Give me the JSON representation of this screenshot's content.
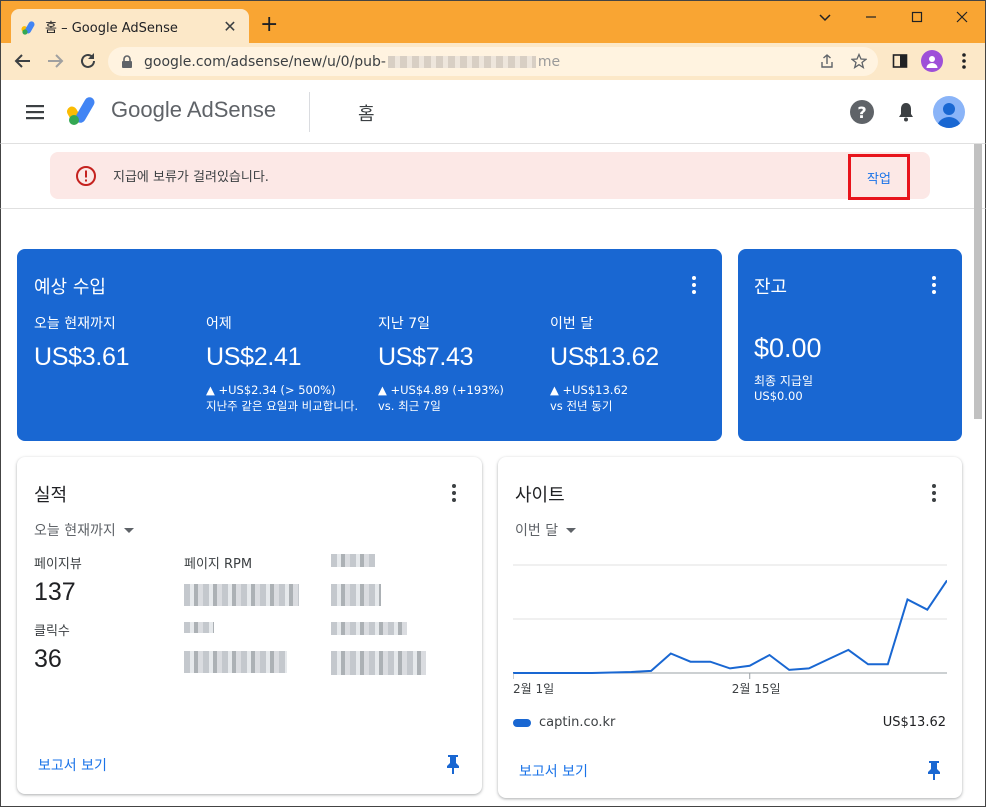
{
  "browser": {
    "tab_title": "홈 – Google AdSense",
    "tab_close": "✕",
    "new_tab": "+",
    "url_start": "google.com/adsense/new/u/0/pub-",
    "url_end": "me",
    "window_controls": [
      "minimize",
      "maximize",
      "close"
    ]
  },
  "appbar": {
    "brand": "Google AdSense",
    "page_title": "홈",
    "help": "?"
  },
  "alert": {
    "message": "지급에 보류가 걸려있습니다.",
    "action_label": "작업",
    "accent": "#e8141c"
  },
  "earnings": {
    "title": "예상 수입",
    "metrics": [
      {
        "label": "오늘 현재까지",
        "value": "US$3.61",
        "sub1": "",
        "sub2": ""
      },
      {
        "label": "어제",
        "value": "US$2.41",
        "sub1": "▲ +US$2.34 (> 500%)",
        "sub2": "지난주 같은 요일과 비교합니다."
      },
      {
        "label": "지난 7일",
        "value": "US$7.43",
        "sub1": "▲ +US$4.89 (+193%)",
        "sub2": "vs. 최근 7일"
      },
      {
        "label": "이번 달",
        "value": "US$13.62",
        "sub1": "▲ +US$13.62",
        "sub2": "vs 전년 동기"
      }
    ]
  },
  "balance": {
    "title": "잔고",
    "value": "$0.00",
    "last_payment_label": "최종 지급일",
    "last_payment_value": "US$0.00"
  },
  "performance": {
    "title": "실적",
    "range": "오늘 현재까지",
    "pageviews_label": "페이지뷰",
    "pageviews_value": "137",
    "page_rpm_label": "페이지 RPM",
    "clicks_label": "클릭수",
    "clicks_value": "36",
    "report_link": "보고서 보기"
  },
  "sites": {
    "title": "사이트",
    "range": "이번 달",
    "report_link": "보고서 보기",
    "legend_site": "captin.co.kr",
    "legend_amount": "US$13.62"
  },
  "chart_data": {
    "type": "line",
    "x_tick_labels": [
      "2월 1일",
      "2월 15일"
    ],
    "x_tick_index": [
      0,
      12
    ],
    "series": [
      {
        "name": "captin.co.kr",
        "values": [
          0,
          0,
          0,
          0,
          0,
          0.01,
          0.02,
          0.04,
          0.38,
          0.22,
          0.22,
          0.09,
          0.14,
          0.35,
          0.06,
          0.09,
          0.27,
          0.45,
          0.17,
          0.17,
          1.43,
          1.23,
          1.8
        ]
      }
    ],
    "ylim": [
      0,
      2.1
    ],
    "grid": true,
    "color": "#1967d2"
  },
  "colors": {
    "tab_bar": "#f9a533",
    "primary_blue": "#1967d2",
    "link_blue": "#1a73e8",
    "alert_bg": "#fce8e6"
  }
}
